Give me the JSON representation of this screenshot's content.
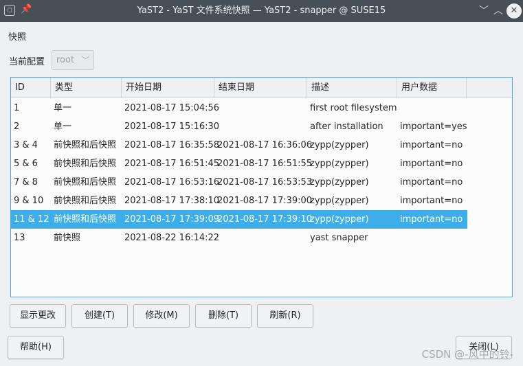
{
  "window": {
    "title": "YaST2 - YaST 文件系统快照 — YaST2 - snapper @ SUSE15",
    "buttons": {
      "minimize": "﹀",
      "maximize": "︿",
      "close": "✕"
    }
  },
  "labels": {
    "snapshots": "快照",
    "current_config": "当前配置"
  },
  "config_select": {
    "value": "root"
  },
  "table": {
    "headers": [
      "ID",
      "类型",
      "开始日期",
      "结束日期",
      "描述",
      "用户数据"
    ],
    "rows": [
      [
        "1",
        "单一",
        "2021-08-17 15:04:56",
        "",
        "first root filesystem",
        ""
      ],
      [
        "2",
        "单一",
        "2021-08-17 15:16:30",
        "",
        "after installation",
        "important=yes"
      ],
      [
        "3 & 4",
        "前快照和后快照",
        "2021-08-17 16:35:58",
        "2021-08-17 16:36:06",
        "zypp(zypper)",
        "important=no"
      ],
      [
        "5 & 6",
        "前快照和后快照",
        "2021-08-17 16:51:45",
        "2021-08-17 16:51:55",
        "zypp(zypper)",
        "important=no"
      ],
      [
        "7 & 8",
        "前快照和后快照",
        "2021-08-17 16:53:16",
        "2021-08-17 16:53:53",
        "zypp(zypper)",
        "important=no"
      ],
      [
        "9 & 10",
        "前快照和后快照",
        "2021-08-17 17:38:10",
        "2021-08-17 17:39:00",
        "zypp(zypper)",
        "important=no"
      ],
      [
        "11 & 12",
        "前快照和后快照",
        "2021-08-17 17:39:09",
        "2021-08-17 17:39:10",
        "zypp(zypper)",
        "important=no"
      ],
      [
        "13",
        "前快照",
        "2021-08-22 16:14:22",
        "",
        "yast snapper",
        ""
      ]
    ],
    "selected_row": 6
  },
  "buttons": {
    "show_changes": "显示更改",
    "create": "创建(T)",
    "modify": "修改(M)",
    "delete": "删除(T)",
    "refresh": "刷新(R)",
    "help": "帮助(H)",
    "close": "关闭(L)"
  },
  "watermark": "CSDN @-风中的铃-"
}
